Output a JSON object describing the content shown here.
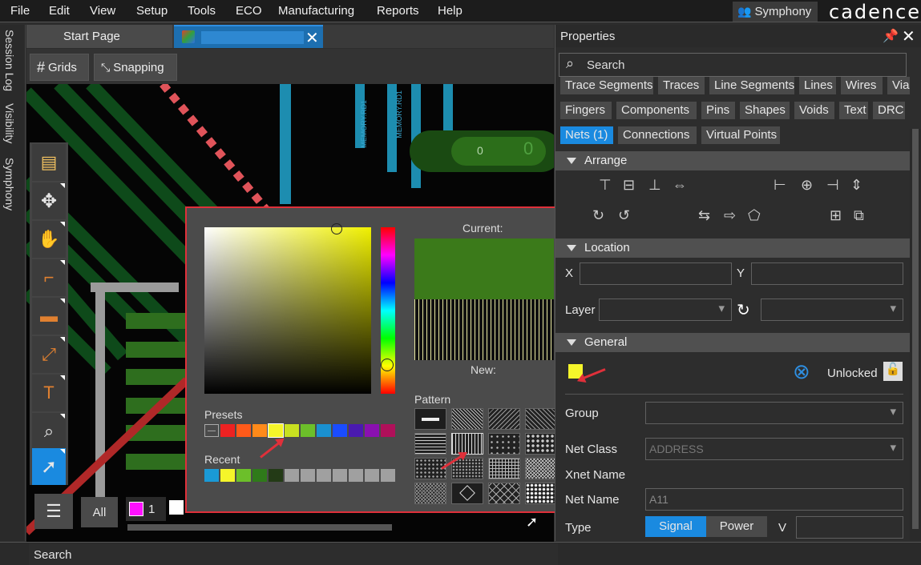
{
  "menubar": {
    "items": [
      "File",
      "Edit",
      "View",
      "Setup",
      "Tools",
      "ECO",
      "Manufacturing",
      "Reports",
      "Help"
    ],
    "symphony_label": "Symphony",
    "brand": "cadence"
  },
  "side_tabs": [
    "Session Log",
    "Visibility",
    "Symphony"
  ],
  "doc_tabs": {
    "start": "Start Page"
  },
  "toolbar": {
    "grids_label": "Grids",
    "snapping_label": "Snapping"
  },
  "canvas": {
    "net_labels": [
      "MEMORY.RD1",
      "MEMORY.RD1"
    ],
    "net_badge_values": [
      "0",
      "0"
    ],
    "layer_count": "1",
    "all_label": "All"
  },
  "color_picker": {
    "current_label": "Current:",
    "new_label": "New:",
    "presets_label": "Presets",
    "recent_label": "Recent",
    "pattern_label": "Pattern",
    "current_color": "#3b7a1a",
    "presets": [
      "#ee2222",
      "#ff5a1a",
      "#ff8a1a",
      "#f5f52a",
      "#c8e020",
      "#6cbf2a",
      "#1a90d0",
      "#1a4cff",
      "#4a1ab0",
      "#8a10b0",
      "#b0105a"
    ],
    "recent": [
      "#1a9ad6",
      "#f5f52a",
      "#6cbf2a",
      "#2f7a1a",
      "#233a16",
      "#a0a0a0",
      "#a0a0a0",
      "#a0a0a0",
      "#a0a0a0",
      "#a0a0a0",
      "#a0a0a0",
      "#a0a0a0"
    ]
  },
  "properties": {
    "title": "Properties",
    "search_placeholder": "Search",
    "chips_row1": [
      "Trace Segments",
      "Traces",
      "Line Segments",
      "Lines",
      "Wires",
      "Vias"
    ],
    "chips_row2": [
      "Fingers",
      "Components",
      "Pins",
      "Shapes",
      "Voids",
      "Text",
      "DRC"
    ],
    "chips_row3": [
      "Nets (1)",
      "Connections",
      "Virtual Points"
    ],
    "arrange_label": "Arrange",
    "location_label": "Location",
    "x_label": "X",
    "y_label": "Y",
    "layer_label": "Layer",
    "general_label": "General",
    "general_color": "#f5f52a",
    "lock_label": "Unlocked",
    "group_label": "Group",
    "net_class_label": "Net Class",
    "net_class_value": "ADDRESS",
    "xnet_name_label": "Xnet Name",
    "net_name_label": "Net Name",
    "net_name_value": "A11",
    "type_label": "Type",
    "type_options": [
      "Signal",
      "Power"
    ],
    "type_selected": "Signal",
    "v_label": "V"
  },
  "statusbar": {
    "search_label": "Search"
  }
}
